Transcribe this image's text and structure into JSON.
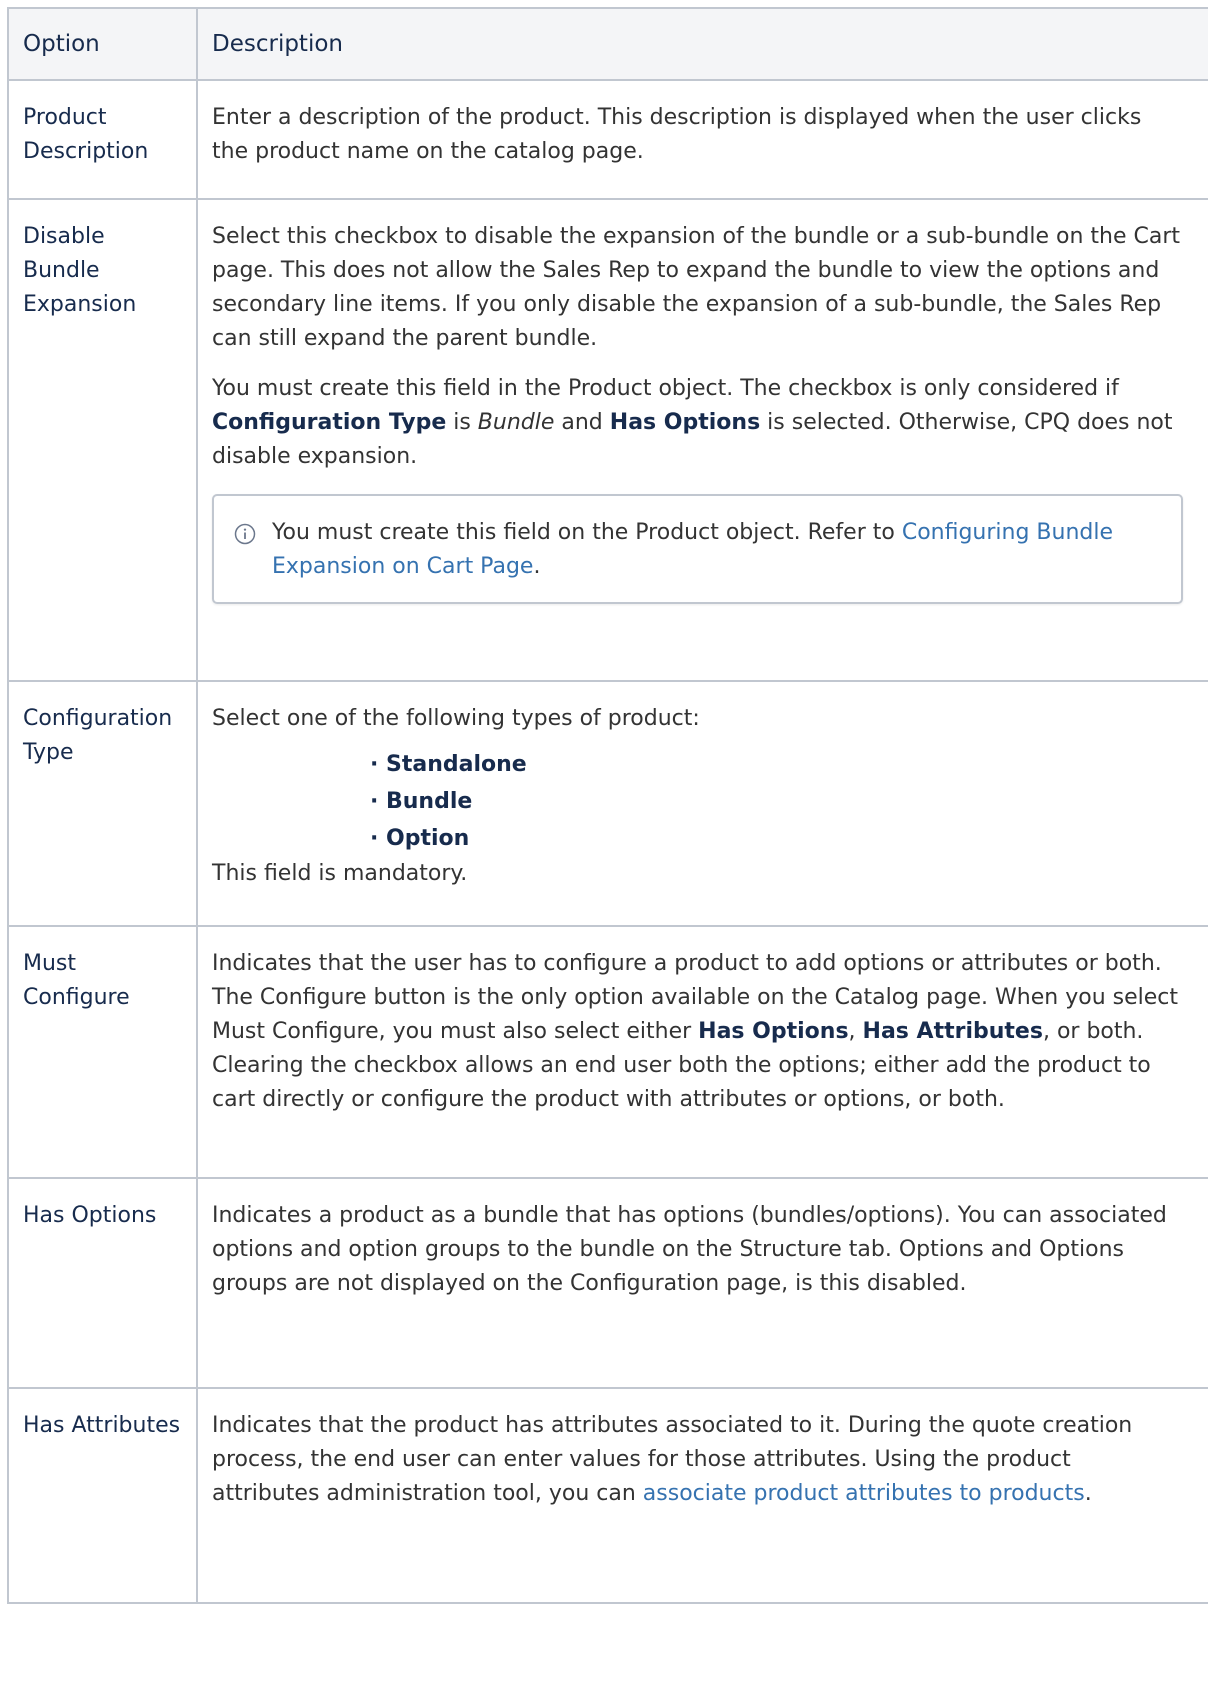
{
  "table": {
    "headers": {
      "option": "Option",
      "description": "Description"
    },
    "rows": [
      {
        "option": "Product Description",
        "description": "Enter a description of the product. This description is displayed when the user clicks the product name on the catalog page."
      },
      {
        "option": "Disable Bundle Expansion",
        "p1": "Select this checkbox to disable the expansion of the bundle or a sub-bundle on the Cart page. This does not allow the Sales Rep to expand the bundle to view the options and secondary line items. If you only disable the expansion of a sub-bundle, the Sales Rep can still expand the parent bundle.",
        "p2_a": "You must create this field in the Product object. The checkbox is only considered if ",
        "p2_b": "Configuration Type",
        "p2_c": " is ",
        "p2_d": "Bundle",
        "p2_e": " and ",
        "p2_f": "Has Options",
        "p2_g": " is selected. Otherwise, CPQ does not disable expansion.",
        "note_text": "You must create this field on the Product object. Refer to ",
        "note_link": "Configuring Bundle Expansion on Cart Page",
        "note_end": "."
      },
      {
        "option": "Configuration Type",
        "intro": "Select one of the following types of product:",
        "types": [
          "Standalone",
          "Bundle",
          "Option"
        ],
        "outro": "This field is mandatory."
      },
      {
        "option": "Must Configure",
        "d_a": "Indicates that the user has to configure a product to add options or attributes or both. The Configure button is the only option available on the Catalog page. When you select Must Configure, you must also select either ",
        "d_b": "Has Options",
        "d_c": ", ",
        "d_d": "Has Attributes",
        "d_e": ", or both. Clearing the checkbox allows an end user both the options; either add the product to cart directly or configure the product with attributes or options, or both."
      },
      {
        "option": "Has Options",
        "description": "Indicates a product as a bundle that has options (bundles/options). You can associated options and option groups to the bundle on the Structure tab. Options and Options groups are not displayed on the Configuration page, is this disabled."
      },
      {
        "option": "Has Attributes",
        "d_a": "Indicates that the product has attributes associated to it. During the quote creation process, the end user can enter values for those attributes. Using the product attributes administration tool, you can ",
        "link": "associate product attributes to products",
        "d_end": "."
      }
    ]
  },
  "colors": {
    "border": "#c1c7d0",
    "header_bg": "#f4f5f7",
    "link": "#3572b0",
    "text": "#333333"
  },
  "icons": {
    "note": "info-icon"
  }
}
